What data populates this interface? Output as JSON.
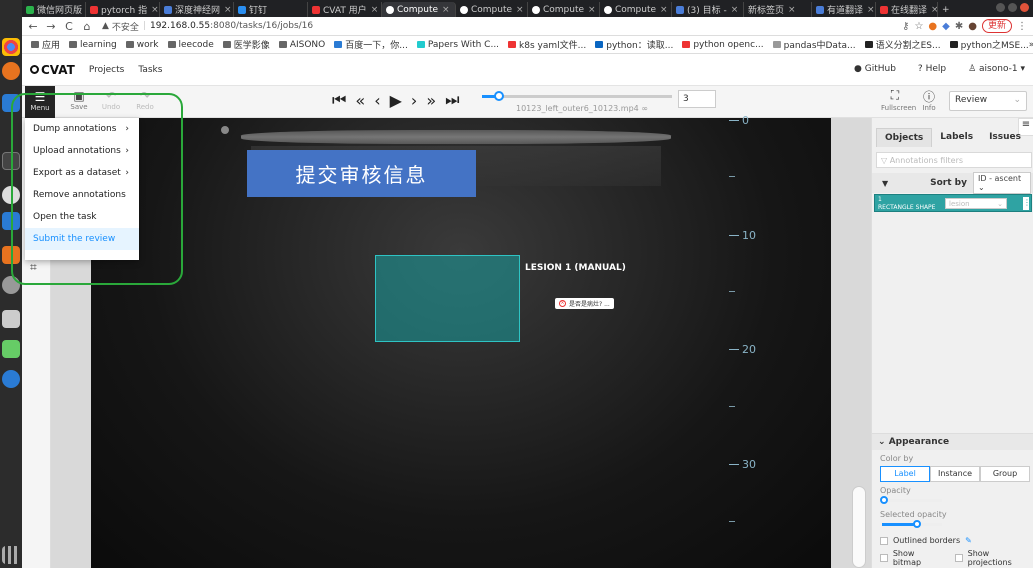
{
  "browser": {
    "tabs": [
      {
        "label": "微信网页版",
        "color": "#2bb24c"
      },
      {
        "label": "pytorch 指",
        "color": "#e33"
      },
      {
        "label": "深度神经网",
        "color": "#4a7dd8"
      },
      {
        "label": "钉钉",
        "color": "#2a8ef0"
      },
      {
        "label": "CVAT 用户",
        "color": "#e33"
      },
      {
        "label": "Compute",
        "color": "#fff",
        "active": true
      },
      {
        "label": "Compute",
        "color": "#fff"
      },
      {
        "label": "Compute",
        "color": "#fff"
      },
      {
        "label": "Compute",
        "color": "#fff"
      },
      {
        "label": "(3) 目标 -",
        "color": "#4a7dd8"
      },
      {
        "label": "新标签页",
        "color": "#888"
      },
      {
        "label": "有道翻译",
        "color": "#4a7dd8"
      },
      {
        "label": "在线翻译",
        "color": "#e33"
      }
    ],
    "insecure_label": "不安全",
    "url_host": "192.168.0.55",
    "url_rest": ":8080/tasks/16/jobs/16",
    "update_label": "更新",
    "bookmarks": [
      "应用",
      "learning",
      "work",
      "leecode",
      "医学影像",
      "AISONO",
      "百度一下，你...",
      "Papers With C...",
      "k8s yaml文件...",
      "python：读取...",
      "python openc...",
      "pandas中Data...",
      "语义分割之ES...",
      "python之MSE..."
    ]
  },
  "header": {
    "logo": "CVAT",
    "nav": [
      "Projects",
      "Tasks"
    ],
    "github": "GitHub",
    "help": "Help",
    "user": "aisono-1"
  },
  "toolbar": {
    "menu_label": "Menu",
    "save_label": "Save",
    "undo_label": "Undo",
    "redo_label": "Redo",
    "filename": "10123_left_outer6_10123.mp4",
    "frame": "3",
    "fullscreen_label": "Fullscreen",
    "info_label": "Info",
    "mode": "Review",
    "playback_progress": 0.09
  },
  "menu": {
    "items": [
      {
        "label": "Dump annotations",
        "submenu": true
      },
      {
        "label": "Upload annotations",
        "submenu": true
      },
      {
        "label": "Export as a dataset",
        "submenu": true
      },
      {
        "label": "Remove annotations",
        "submenu": false
      },
      {
        "label": "Open the task",
        "submenu": false
      },
      {
        "label": "Submit the review",
        "submenu": false,
        "active": true
      }
    ]
  },
  "canvas": {
    "banner": "提交审核信息",
    "bbox_label": "LESION 1 (MANUAL)",
    "issue_label": "是否是病灶? ...",
    "ruler_ticks": [
      "0",
      "10",
      "20",
      "30"
    ]
  },
  "sidebar": {
    "tabs": [
      "Objects",
      "Labels",
      "Issues"
    ],
    "filter_placeholder": "Annotations filters",
    "sort_by_label": "Sort by",
    "sort_value": "ID - ascent",
    "object_id": "1",
    "object_type": "RECTANGLE SHAPE",
    "object_label": "lesion",
    "appearance": {
      "title": "Appearance",
      "color_by_label": "Color by",
      "color_by_options": [
        "Label",
        "Instance",
        "Group"
      ],
      "color_by_selected": "Label",
      "opacity_label": "Opacity",
      "opacity_value": 0.05,
      "selected_opacity_label": "Selected opacity",
      "selected_opacity_value": 0.6,
      "outlined_borders": "Outlined borders",
      "show_bitmap": "Show bitmap",
      "show_projections": "Show projections"
    }
  },
  "colors": {
    "accent": "#1890ff",
    "object": "#2fa3a3",
    "banner": "#4473c5",
    "highlight": "#2aa83a"
  }
}
